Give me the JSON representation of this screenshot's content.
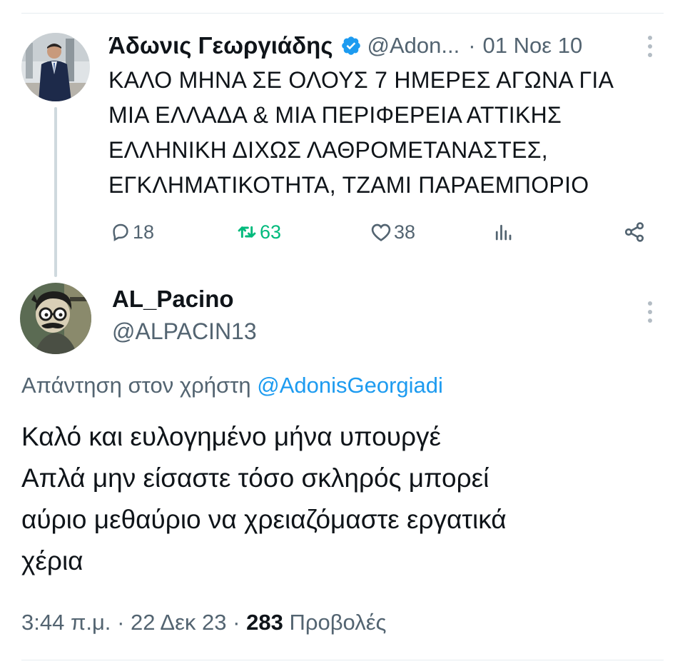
{
  "original_post": {
    "author_name": "Άδωνις Γεωργιάδης",
    "handle": "@Adon...",
    "separator": "·",
    "date": "01 Νοε 10",
    "text_lines": [
      "ΚΑΛΟ ΜΗΝΑ ΣΕ ΟΛΟΥΣ 7 ΗΜΕΡΕΣ ΑΓΩΝΑ ΓΙΑ",
      "ΜΙΑ ΕΛΛΑΔΑ & ΜΙΑ ΠΕΡΙΦΕΡΕΙΑ ΑΤΤΙΚΗΣ",
      "ΕΛΛΗΝΙΚΗ ΔΙΧΩΣ ΛΑΘΡΟΜΕΤΑΝΑΣΤΕΣ,",
      "ΕΓΚΛΗΜΑΤΙΚΟΤΗΤΑ, ΤΖΑΜΙ ΠΑΡΑΕΜΠΟΡΙΟ"
    ],
    "actions": {
      "replies": "18",
      "retweets": "63",
      "likes": "38"
    }
  },
  "reply_post": {
    "author_name": "AL_Pacino",
    "handle": "@ALPACIN13",
    "reply_to_label": "Απάντηση στον χρήστη",
    "reply_to_mention": "@AdonisGeorgiadi",
    "text_lines": [
      "Καλό και ευλογημένο μήνα υπουργέ",
      "Απλά μην είσαστε τόσο σκληρός μπορεί",
      "αύριο μεθαύριο να χρειαζόμαστε εργατικά",
      "χέρια"
    ],
    "time": "3:44 π.μ.",
    "separator": "·",
    "date": "22 Δεκ 23",
    "views_count": "283",
    "views_label": "Προβολές"
  },
  "icons": {
    "verified": "verified-badge-icon",
    "reply": "reply-bubble-icon",
    "retweet": "retweet-icon",
    "like": "heart-icon",
    "views": "views-bar-chart-icon",
    "share": "share-icon",
    "more": "more-vertical-icon"
  },
  "colors": {
    "text": "#0f1419",
    "secondary": "#536471",
    "accent": "#1d9bf0",
    "retweet": "#00ba7c",
    "thread_line": "#cfd9de"
  }
}
